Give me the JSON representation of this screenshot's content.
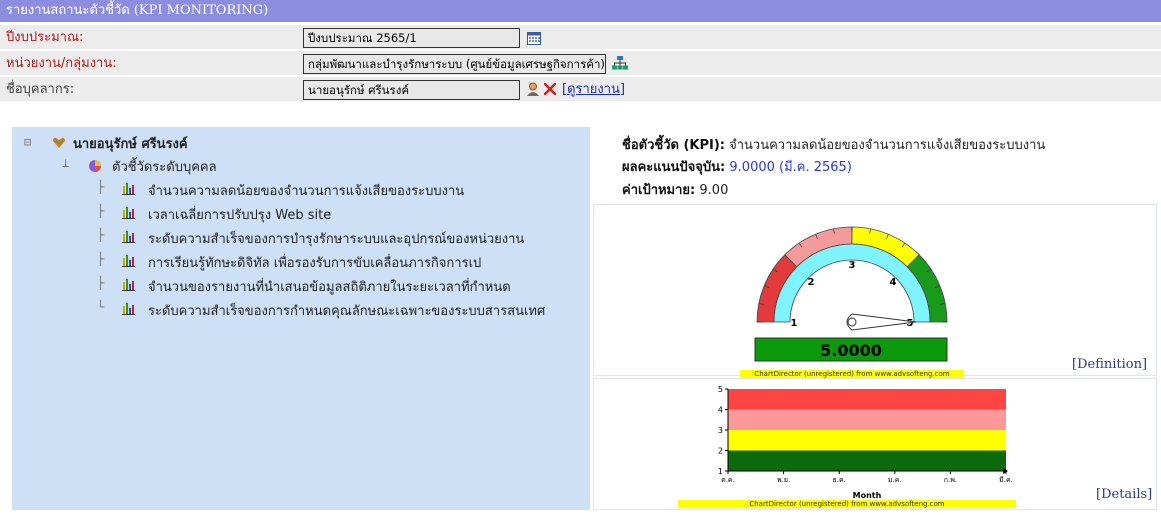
{
  "header": {
    "title": "รายงานสถานะตัวชี้วัด (KPI MONITORING)"
  },
  "form": {
    "fiscal_year_label": "ปีงบประมาณ:",
    "fiscal_year_value": "ปีงบประมาณ 2565/1",
    "unit_label": "หน่วยงาน/กลุ่มงาน:",
    "unit_value": "กลุ่มพัฒนาและบำรุงรักษาระบบ (ศูนย์ข้อมูลเศรษฐกิจการค้า)",
    "person_label": "ชื่อบุคลากร:",
    "person_value": "นายอนุรักษ์ ศรีนรงค์",
    "view_report_link": "[ดูรายงาน]"
  },
  "tree": {
    "root": "นายอนุรักษ์ ศรีนรงค์",
    "group": "ตัวชี้วัดระดับบุคคล",
    "items": [
      "จำนวนความลดน้อยของจำนวนการแจ้งเสียของระบบงาน",
      "เวลาเฉลี่ยการปรับปรุง Web site",
      "ระดับความสำเร็จของการบำรุงรักษาระบบและอุปกรณ์ของหน่วยงาน",
      "การเรียนรู้ทักษะดิจิทัล เพื่อรองรับการขับเคลื่อนภารกิจการเป",
      "จำนวนของรายงานที่นำเสนอข้อมูลสถิติภายในระยะเวลาที่กำหนด",
      "ระดับความสำเร็จของการกำหนดคุณลักษณะเฉพาะของระบบสารสนเทศ"
    ]
  },
  "kpi": {
    "name_label": "ชื่อตัวชี้วัด (KPI):",
    "name_value": "จำนวนความลดน้อยของจำนวนการแจ้งเสียของระบบงาน",
    "score_label": "ผลคะแนนปัจจุบัน:",
    "score_value": "9.0000 (มี.ค. 2565)",
    "target_label": "ค่าเป้าหมาย:",
    "target_value": "9.00"
  },
  "gauge": {
    "value": 5,
    "display": "5.0000",
    "min": 1,
    "max": 5,
    "ticks": [
      "1",
      "2",
      "3",
      "4",
      "5"
    ],
    "zones": [
      {
        "from": 1,
        "to": 2,
        "color": "#e23b3b"
      },
      {
        "from": 2,
        "to": 3,
        "color": "#f39a9a"
      },
      {
        "from": 3,
        "to": 4,
        "color": "#ffff00"
      },
      {
        "from": 4,
        "to": 5,
        "color": "#1a9a1a"
      }
    ],
    "watermark": "ChartDirector (unregistered) from www.advsofteng.com",
    "definition_link": "[Definition]"
  },
  "chart_data": {
    "type": "area",
    "xlabel": "Month",
    "ylabel": "",
    "categories": [
      "ต.ค.",
      "พ.ย.",
      "ธ.ค.",
      "ม.ค.",
      "ก.พ.",
      "มี.ค."
    ],
    "ylim": [
      1,
      5
    ],
    "yticks": [
      "1",
      "2",
      "3",
      "4",
      "5"
    ],
    "bands": [
      {
        "from": 1,
        "to": 2,
        "color": "#0b6b0b"
      },
      {
        "from": 2,
        "to": 3,
        "color": "#ffff00"
      },
      {
        "from": 3,
        "to": 4,
        "color": "#ff9999"
      },
      {
        "from": 4,
        "to": 5,
        "color": "#ff4444"
      }
    ],
    "watermark": "ChartDirector (unregistered) from www.advsofteng.com",
    "details_link": "[Details]"
  }
}
